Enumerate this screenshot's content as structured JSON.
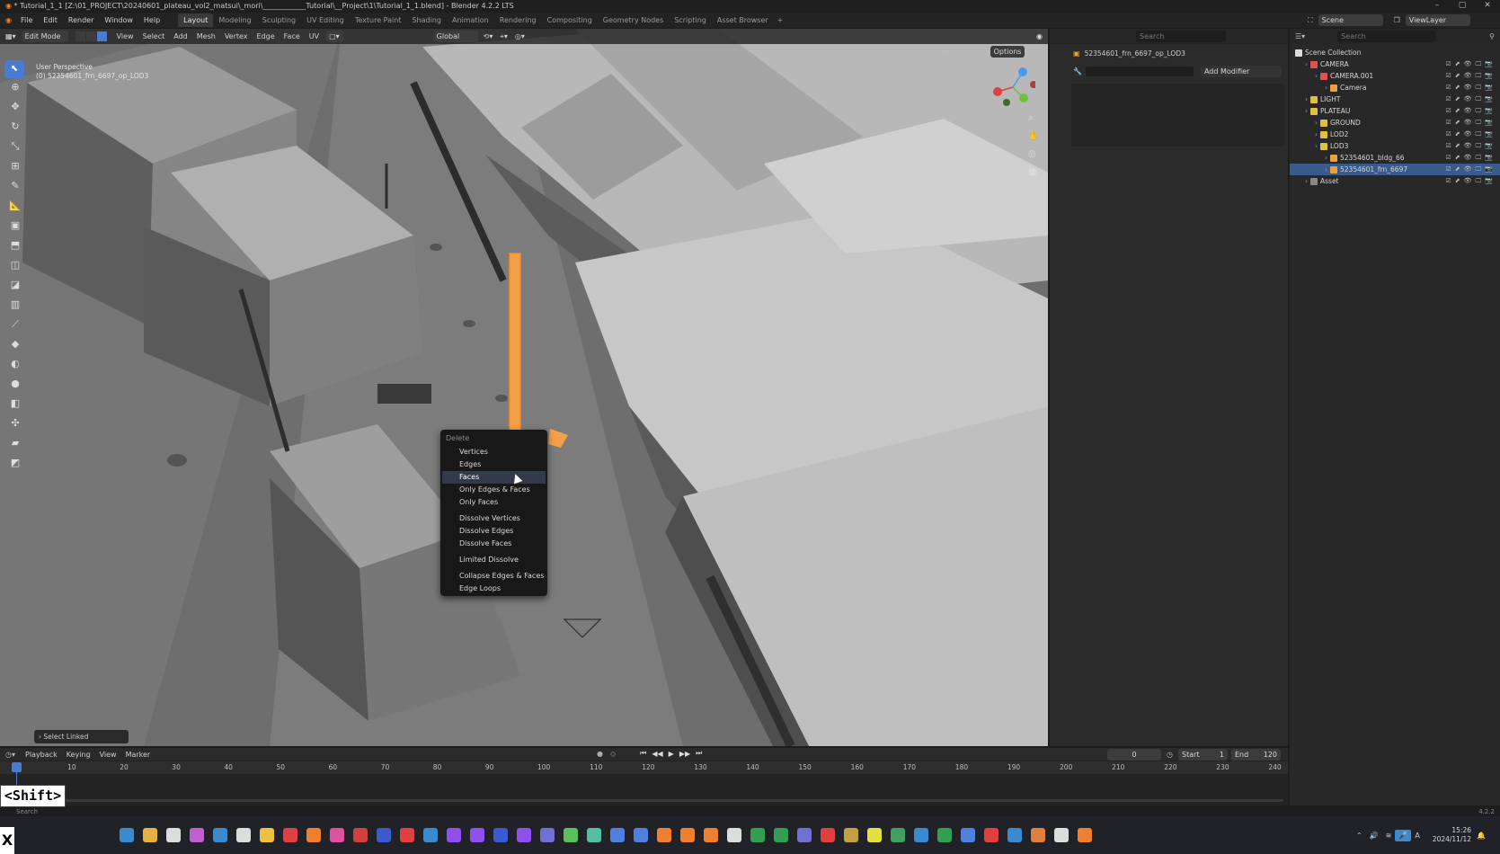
{
  "window": {
    "title": "* Tutorial_1_1 [Z:\\01_PROJECT\\20240601_plateau_vol2_matsui\\_mori\\____________Tutorial\\__Project\\1\\Tutorial_1_1.blend] - Blender 4.2.2 LTS"
  },
  "menubar": {
    "items": [
      "File",
      "Edit",
      "Render",
      "Window",
      "Help"
    ],
    "workspaces": [
      "Layout",
      "Modeling",
      "Sculpting",
      "UV Editing",
      "Texture Paint",
      "Shading",
      "Animation",
      "Rendering",
      "Compositing",
      "Geometry Nodes",
      "Scripting",
      "Asset Browser"
    ],
    "active_workspace": "Layout",
    "scene": "Scene",
    "view_layer": "ViewLayer"
  },
  "viewport_header": {
    "mode": "Edit Mode",
    "menus": [
      "View",
      "Select",
      "Add",
      "Mesh",
      "Vertex",
      "Edge",
      "Face",
      "UV"
    ],
    "orientation": "Global",
    "options_label": "Options",
    "axes": [
      "X",
      "Y",
      "Z"
    ]
  },
  "viewport": {
    "overlay_line1": "User Perspective",
    "overlay_line2": "(0) 52354601_frn_6697_op_LOD3",
    "last_operator": "Select Linked",
    "gizmo_labels": [
      "X",
      "Y",
      "Z"
    ]
  },
  "context_menu": {
    "title": "Delete",
    "groups": [
      [
        "Vertices",
        "Edges",
        "Faces",
        "Only Edges & Faces",
        "Only Faces"
      ],
      [
        "Dissolve Vertices",
        "Dissolve Edges",
        "Dissolve Faces"
      ],
      [
        "Limited Dissolve"
      ],
      [
        "Collapse Edges & Faces",
        "Edge Loops"
      ]
    ],
    "highlighted": "Faces"
  },
  "properties": {
    "object_name": "52354601_frn_6697_op_LOD3",
    "add_modifier": "Add Modifier",
    "search_placeholder": "Search"
  },
  "outliner": {
    "search_placeholder": "Search",
    "rows": [
      {
        "label": "Scene Collection",
        "depth": 0,
        "icon": "collection",
        "color": "#dddddd"
      },
      {
        "label": "CAMERA",
        "depth": 1,
        "icon": "collection",
        "color": "#e05050"
      },
      {
        "label": "CAMERA.001",
        "depth": 2,
        "icon": "collection",
        "color": "#e05050"
      },
      {
        "label": "Camera",
        "depth": 3,
        "icon": "camera",
        "color": "#e8a040"
      },
      {
        "label": "LIGHT",
        "depth": 1,
        "icon": "collection",
        "color": "#e0c040"
      },
      {
        "label": "PLATEAU",
        "depth": 1,
        "icon": "collection",
        "color": "#e0c040"
      },
      {
        "label": "GROUND",
        "depth": 2,
        "icon": "collection",
        "color": "#e0c040"
      },
      {
        "label": "LOD2",
        "depth": 2,
        "icon": "collection",
        "color": "#e0c040"
      },
      {
        "label": "LOD3",
        "depth": 2,
        "icon": "collection",
        "color": "#e0c040"
      },
      {
        "label": "52354601_bldg_66",
        "depth": 3,
        "icon": "mesh",
        "color": "#e8a040"
      },
      {
        "label": "52354601_frn_6697",
        "depth": 3,
        "icon": "mesh",
        "color": "#e8a040",
        "selected": true
      },
      {
        "label": "Asset",
        "depth": 1,
        "icon": "collection",
        "color": "#888888"
      }
    ]
  },
  "timeline": {
    "menus": [
      "Playback",
      "Keying",
      "View",
      "Marker"
    ],
    "current_frame": "0",
    "start_label": "Start",
    "start": "1",
    "end_label": "End",
    "end": "120",
    "ticks": [
      "0",
      "10",
      "20",
      "30",
      "40",
      "50",
      "60",
      "70",
      "80",
      "90",
      "100",
      "110",
      "120",
      "130",
      "140",
      "150",
      "160",
      "170",
      "180",
      "190",
      "200",
      "210",
      "220",
      "230",
      "240"
    ]
  },
  "status": {
    "key_overlay": "<Shift>",
    "x_key": "X",
    "version": "4.2.2",
    "search_label": "Search"
  },
  "taskbar": {
    "time": "15:26",
    "date": "2024/11/12"
  },
  "colors": {
    "accent": "#4a7bd0",
    "selection": "#f0a040",
    "viewport_bg": "#6f6f6f",
    "menu_highlight": "#333b4a"
  }
}
